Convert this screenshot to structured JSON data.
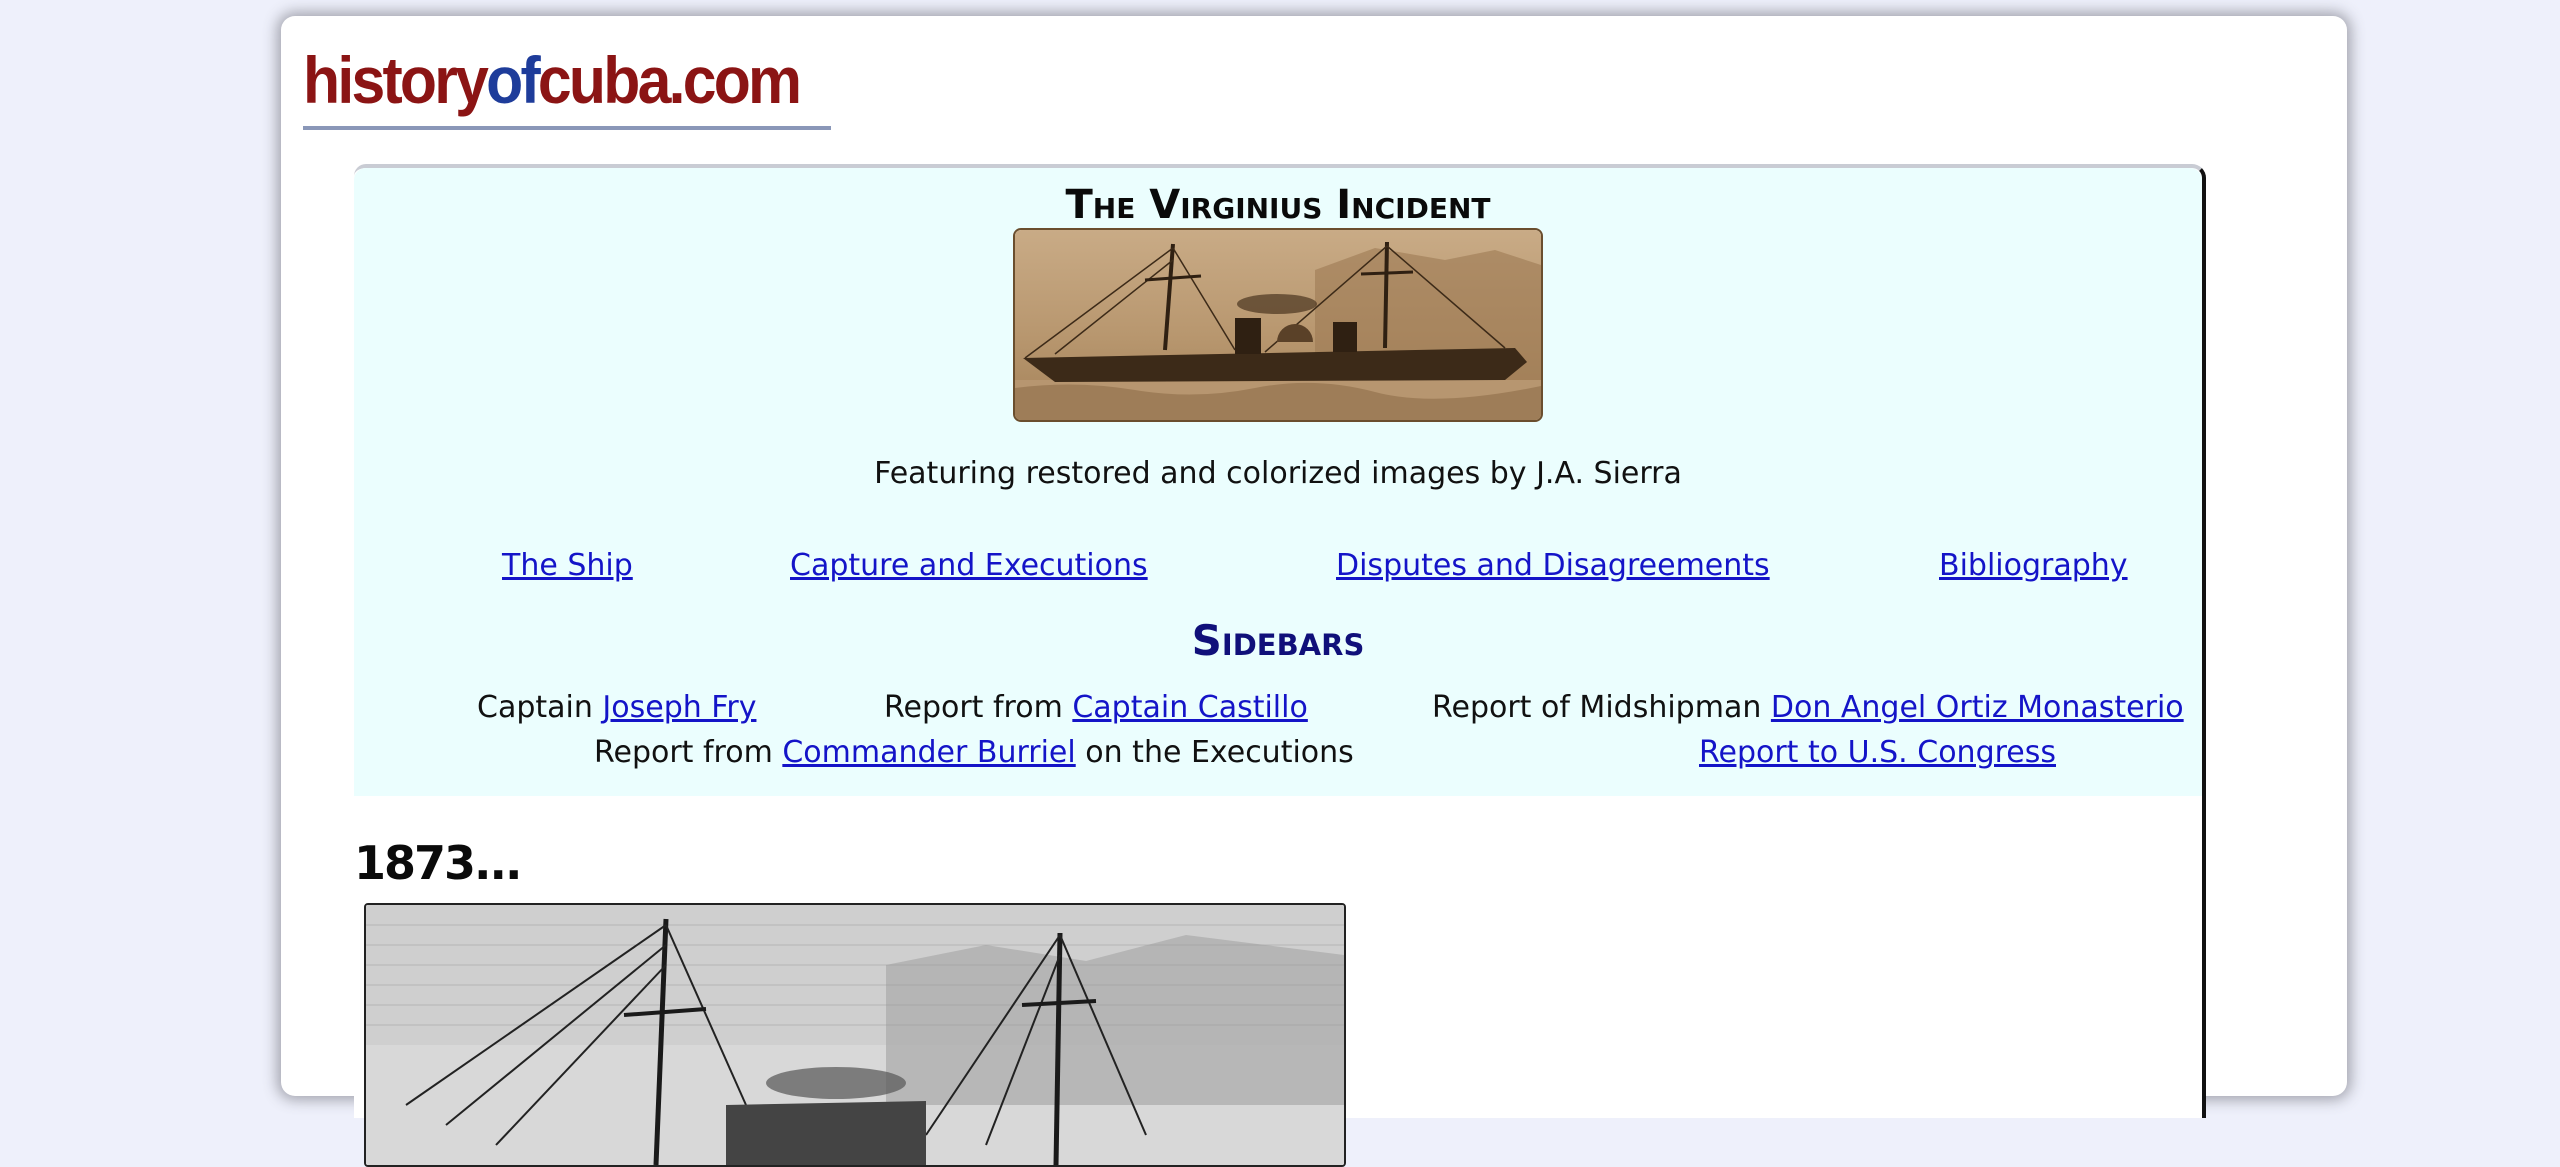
{
  "site": {
    "logo_parts": [
      "history",
      "of",
      "cuba",
      ".com"
    ],
    "logo_colors": [
      "#8b1414",
      "#1e3c9a",
      "#8b1414",
      "#8b1414"
    ]
  },
  "article": {
    "title": "The Virginius Incident",
    "caption": "Featuring restored and colorized images by J.A. Sierra",
    "nav": [
      {
        "label": "The Ship"
      },
      {
        "label": "Capture and Executions"
      },
      {
        "label": "Disputes and Disagreements"
      },
      {
        "label": "Bibliography"
      }
    ],
    "sidebars_title": "Sidebars",
    "sidebars": {
      "fry_prefix": "Captain ",
      "fry_link": "Joseph Fry",
      "castillo_prefix": "Report from ",
      "castillo_link": "Captain Castillo",
      "ortiz_prefix": "Report of Midshipman ",
      "ortiz_link": "Don Angel Ortiz Monasterio",
      "burriel_prefix": "Report from ",
      "burriel_link": "Commander Burriel",
      "burriel_suffix": " on the Executions",
      "congress_link": "Report to U.S. Congress"
    },
    "year_heading": "1873..."
  },
  "colors": {
    "link": "#1414c8",
    "info_box_bg": "#ebfefe",
    "sidebars_heading": "#10107a",
    "page_bg": "#eef0fb"
  }
}
